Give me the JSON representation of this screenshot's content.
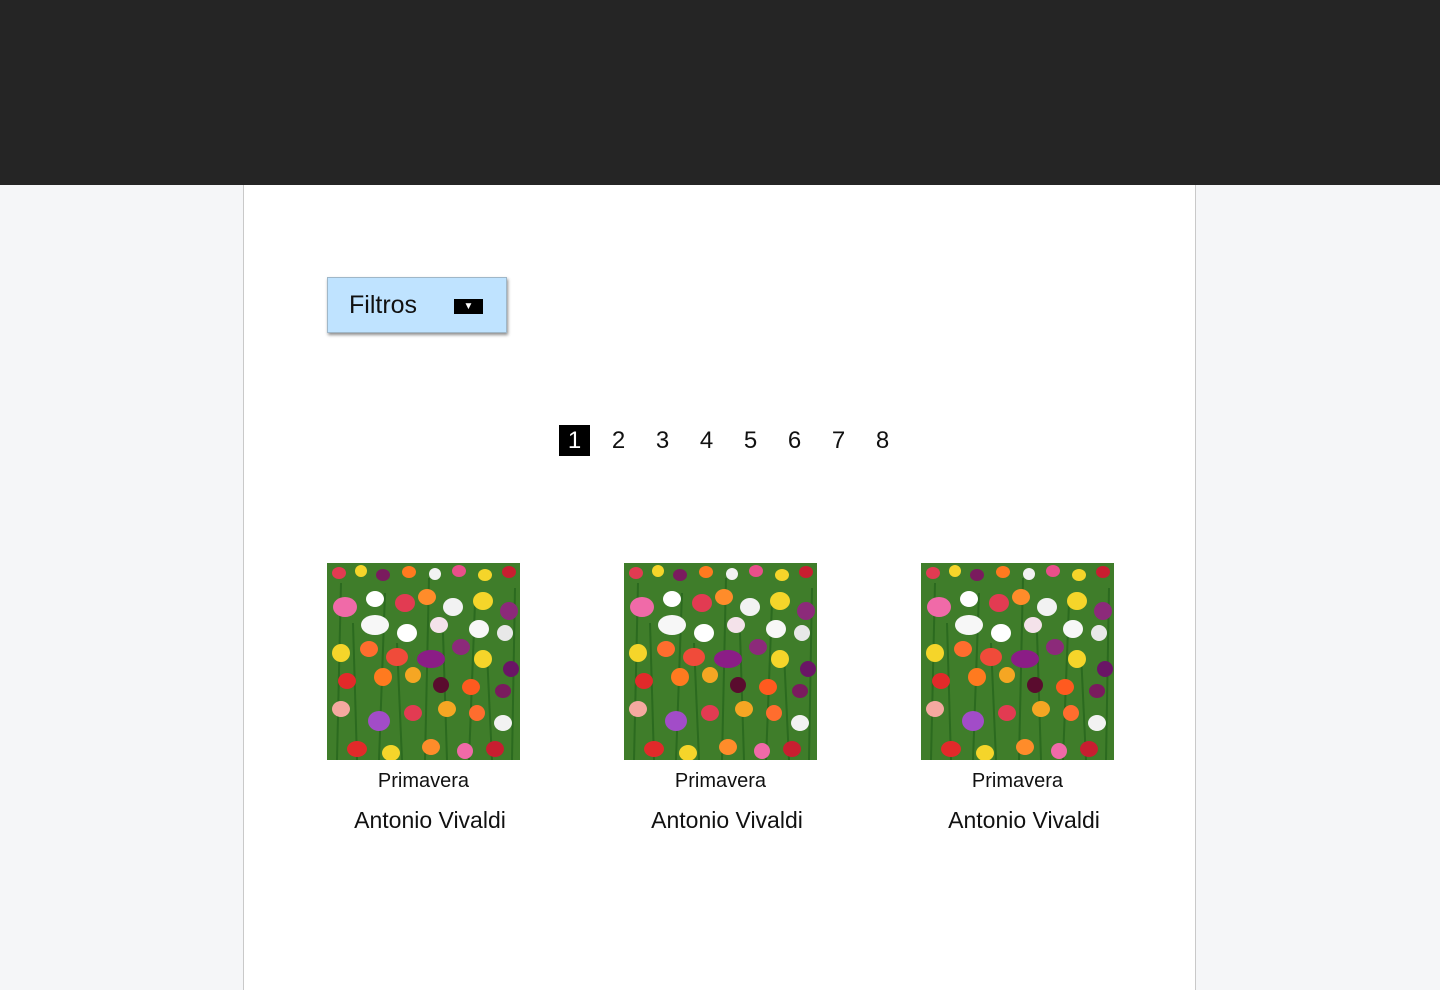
{
  "filters": {
    "label": "Filtros",
    "caret": "▼"
  },
  "pagination": {
    "pages": [
      "1",
      "2",
      "3",
      "4",
      "5",
      "6",
      "7",
      "8"
    ],
    "current": "1"
  },
  "cards": [
    {
      "title": "Primavera",
      "artist": "Antonio Vivaldi",
      "image": "flower-field-image"
    },
    {
      "title": "Primavera",
      "artist": "Antonio Vivaldi",
      "image": "flower-field-image"
    },
    {
      "title": "Primavera",
      "artist": "Antonio Vivaldi",
      "image": "flower-field-image"
    }
  ],
  "colors": {
    "topbar": "#252525",
    "page_bg": "#f5f6f8",
    "content_bg": "#ffffff",
    "filters_bg": "#bfe3ff",
    "active_page_bg": "#000000"
  }
}
